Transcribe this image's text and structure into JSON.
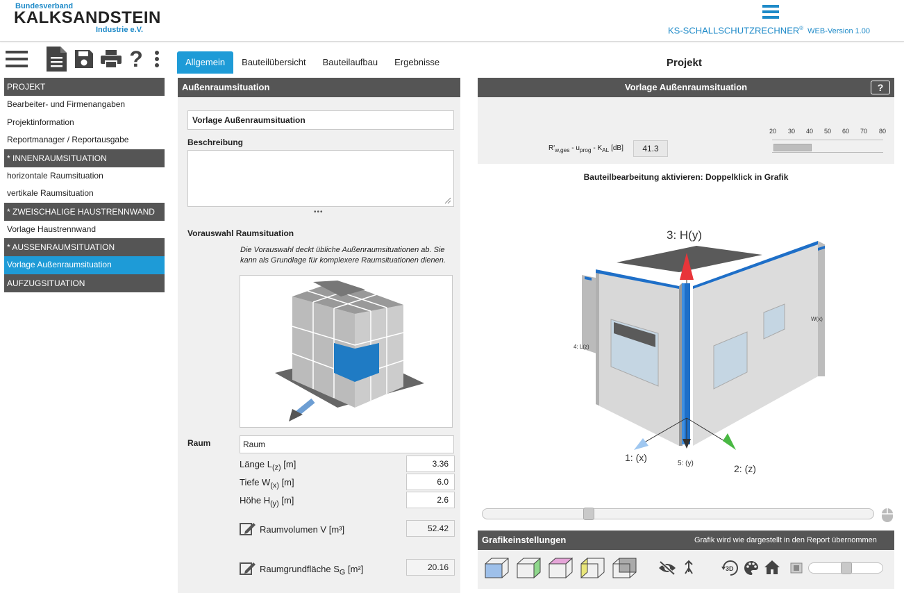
{
  "header": {
    "logo_top": "Bundesverband",
    "logo_main": "KALKSANDSTEIN",
    "logo_sub": "Industrie e.V.",
    "app_name": "KS-SCHALLSCHUTZRECHNER",
    "app_reg": "®",
    "app_version": "WEB-Version 1.00"
  },
  "toolbar": {
    "icons": [
      "menu-icon",
      "document-icon",
      "save-icon",
      "print-icon",
      "help-icon",
      "more-vertical-icon"
    ]
  },
  "sidebar": {
    "sections": [
      {
        "title": "PROJEKT",
        "items": [
          "Bearbeiter- und Firmenangaben",
          "Projektinformation",
          "Reportmanager / Reportausgabe"
        ]
      },
      {
        "title": "* INNENRAUMSITUATION",
        "items": [
          "horizontale Raumsituation",
          "vertikale Raumsituation"
        ]
      },
      {
        "title": "* ZWEISCHALIGE HAUSTRENNWAND",
        "items": [
          "Vorlage Haustrennwand"
        ]
      },
      {
        "title": "* AUSSENRAUMSITUATION",
        "items": [
          "Vorlage Außenraumsituation"
        ]
      },
      {
        "title": "AUFZUGSITUATION",
        "items": []
      }
    ],
    "active_item": "Vorlage Außenraumsituation"
  },
  "tabs": [
    "Allgemein",
    "Bauteilübersicht",
    "Bauteilaufbau",
    "Ergebnisse"
  ],
  "active_tab": "Allgemein",
  "project_title": "Projekt",
  "middle": {
    "panel_title": "Außenraumsituation",
    "name_value": "Vorlage Außenraumsituation",
    "description_label": "Beschreibung",
    "description_value": "",
    "ellipsis": "•••",
    "preselect_label": "Vorauswahl Raumsituation",
    "preselect_note": "Die Vorauswahl deckt übliche Außenraumsituationen ab. Sie kann als Grundlage für komplexere Raumsituationen dienen.",
    "room_label": "Raum",
    "room_value": "Raum",
    "laenge_label": "Länge L",
    "laenge_sub": "(z)",
    "laenge_unit": " [m]",
    "laenge_value": "3.36",
    "tiefe_label": "Tiefe W",
    "tiefe_sub": "(x)",
    "tiefe_unit": " [m]",
    "tiefe_value": "6.0",
    "hoehe_label": "Höhe H",
    "hoehe_sub": "(y)",
    "hoehe_unit": " [m]",
    "hoehe_value": "2.6",
    "volumen_label": "Raumvolumen V [m³]",
    "volumen_value": "52.42",
    "grund_label": "Raumgrundfläche S",
    "grund_sub": "G",
    "grund_unit": " [m²]",
    "grund_value": "20.16"
  },
  "right": {
    "panel_title": "Vorlage Außenraumsituation",
    "help_label": "?",
    "formula_r": "R'",
    "formula_rsub": "w,ges",
    "formula_mid": " - u",
    "formula_usub": "prog",
    "formula_k": " - K",
    "formula_ksub": "AL",
    "formula_unit": " [dB]",
    "result_value": "41.3",
    "scale_ticks": [
      "20",
      "30",
      "40",
      "50",
      "60",
      "70",
      "80"
    ],
    "scale_value": 41.3,
    "hint": "Bauteilbearbeitung aktivieren: Doppelklick in Grafik",
    "axis_labels": {
      "h": "3: H(y)",
      "x": "1: (x)",
      "y5": "5: (y)",
      "z": "2: (z)",
      "l": "4: L(z)",
      "w": "W(x)"
    },
    "slider_level": 0.27,
    "graphics_title": "Grafikeinstellungen",
    "graphics_note": "Grafik wird wie dargestellt in den Report übernommen",
    "graphics_icons": [
      "cube-blue-icon",
      "cube-green-icon",
      "cube-pink-icon",
      "cube-yellow-icon",
      "cube-gray-icon",
      "eye-off-icon",
      "arrow-up-icon",
      "rotate-3d-icon",
      "palette-icon",
      "home-icon",
      "brightness-icon"
    ],
    "brightness_level": 0.5,
    "colors": {
      "accent": "#1e9bd7",
      "dark": "#555555",
      "wall_blue": "#1e6fc8",
      "cube_blue": "#1f7bc4"
    }
  }
}
